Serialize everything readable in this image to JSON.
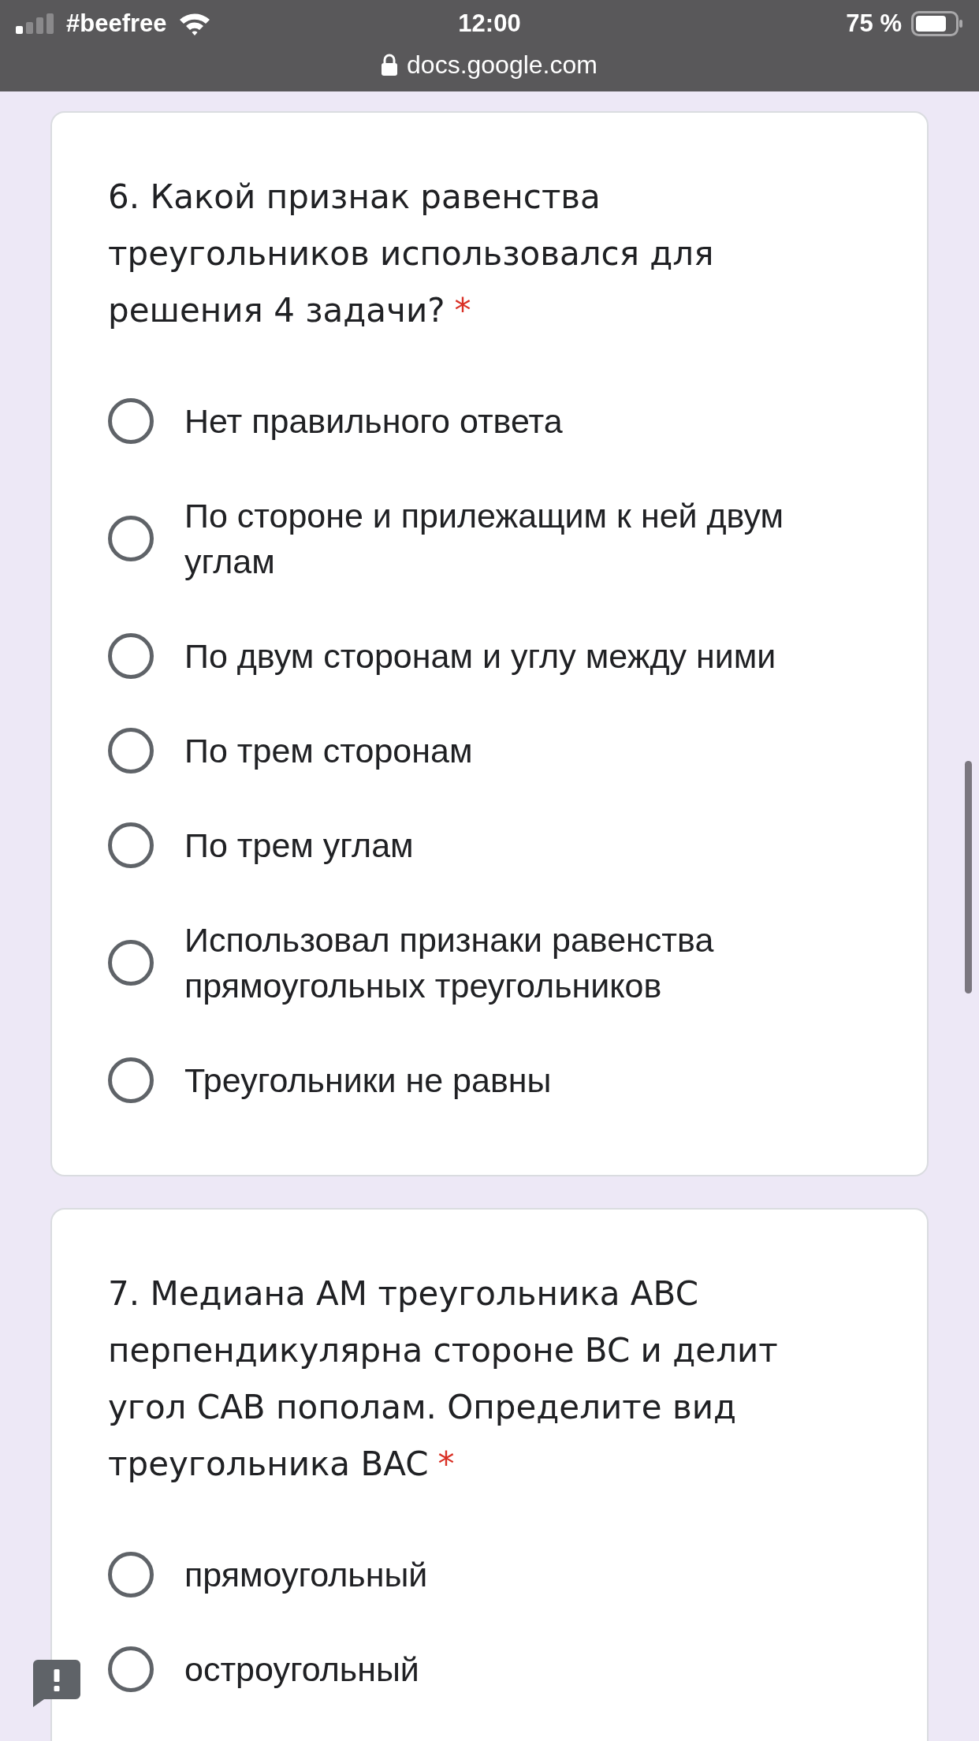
{
  "status_bar": {
    "carrier": "#beefree",
    "time": "12:00",
    "battery": "75 %",
    "url": "docs.google.com"
  },
  "questions": [
    {
      "title": "6. Какой признак равенства треугольников использовался для решения 4 задачи?",
      "required_mark": "*",
      "options": [
        {
          "label": "Нет правильного ответа",
          "selected": false
        },
        {
          "label": "По стороне и прилежащим к ней двум углам",
          "selected": false
        },
        {
          "label": "По двум сторонам и углу между ними",
          "selected": false
        },
        {
          "label": "По трем сторонам",
          "selected": false
        },
        {
          "label": "По трем углам",
          "selected": false
        },
        {
          "label": "Использовал признаки равенства прямоугольных треугольников",
          "selected": false
        },
        {
          "label": "Треугольники не равны",
          "selected": false
        }
      ]
    },
    {
      "title": "7. Медиана AM треугольника ABC перпендикулярна стороне BC и делит угол CAB пополам. Определите вид треугольника BAC",
      "required_mark": "*",
      "options": [
        {
          "label": "прямоугольный",
          "selected": false
        },
        {
          "label": "остроугольный",
          "selected": false
        }
      ]
    }
  ]
}
